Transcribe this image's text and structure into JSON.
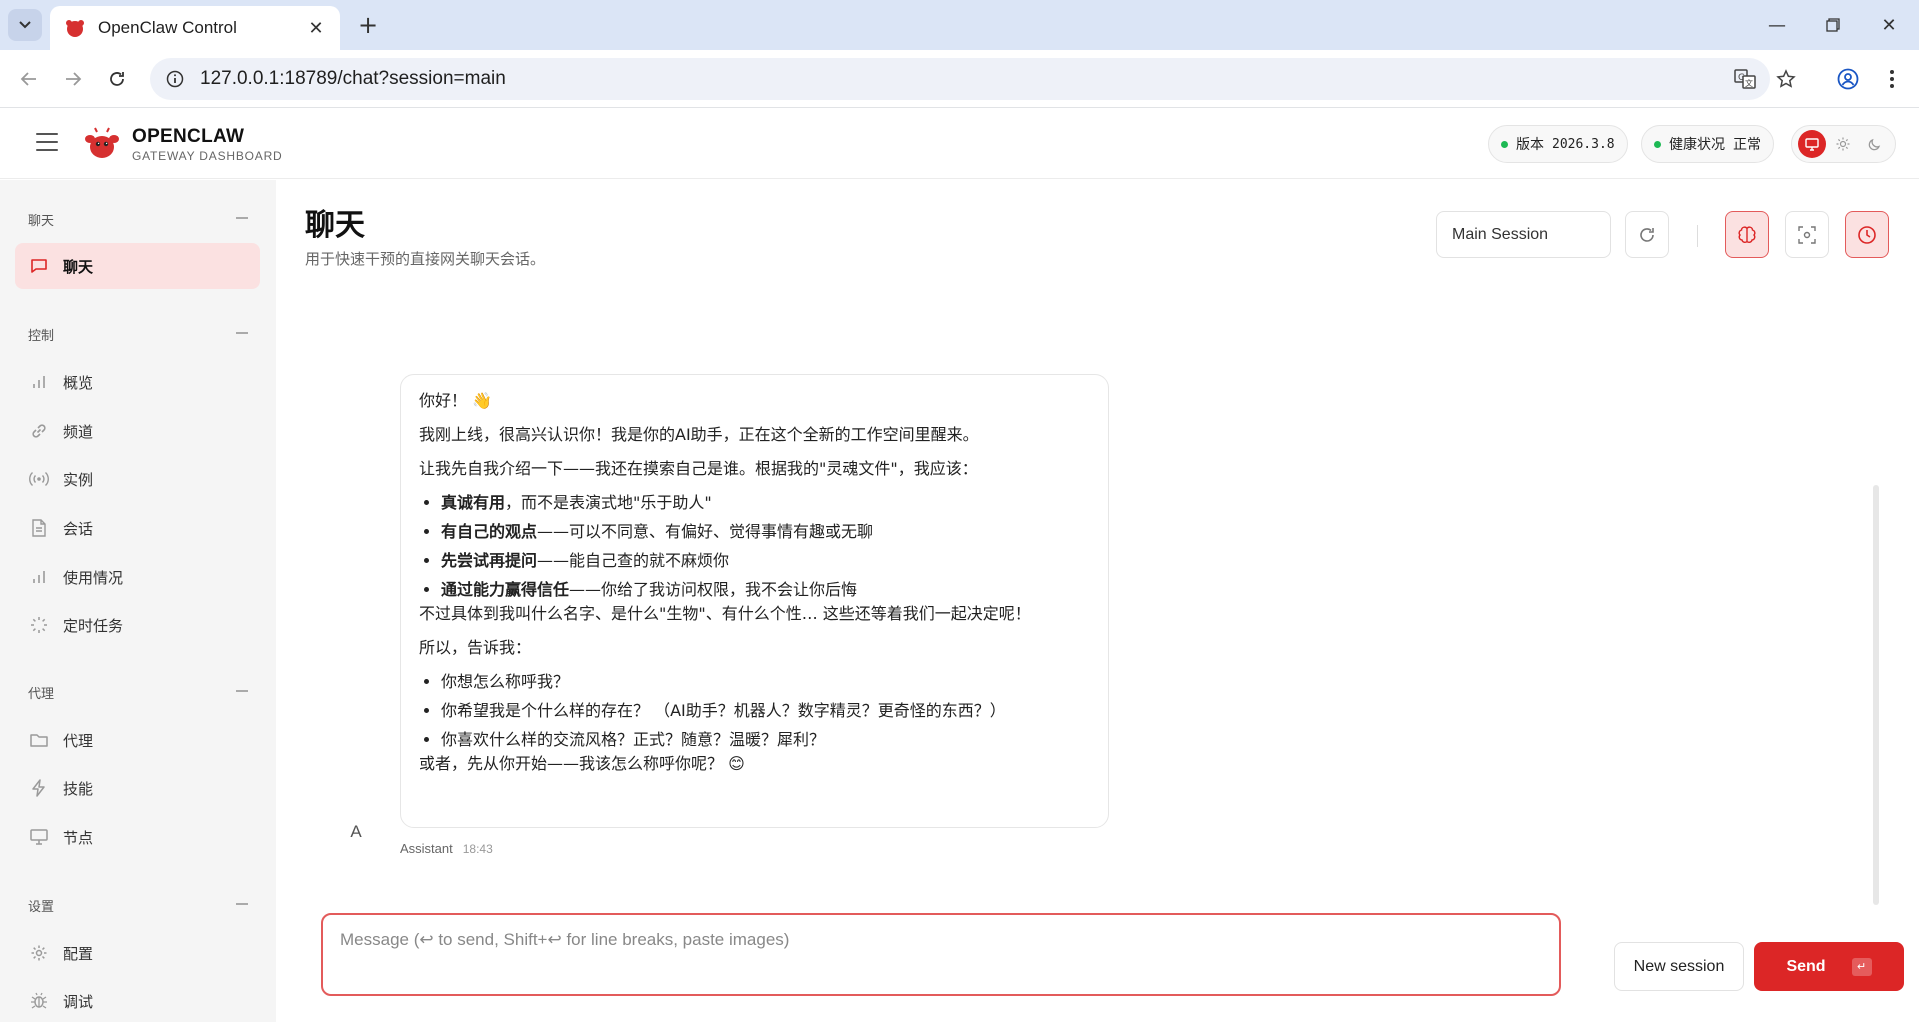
{
  "browser": {
    "tab_title": "OpenClaw Control",
    "url": "127.0.0.1:18789/chat?session=main"
  },
  "header": {
    "brand_name": "OPENCLAW",
    "brand_sub": "GATEWAY DASHBOARD",
    "version_label": "版本",
    "version_value": "2026.3.8",
    "health_label": "健康状况",
    "health_value": "正常"
  },
  "sidebar": {
    "sections": [
      {
        "label": "聊天",
        "items": [
          {
            "label": "聊天",
            "icon": "chat-icon"
          }
        ]
      },
      {
        "label": "控制",
        "items": [
          {
            "label": "概览",
            "icon": "bar-chart-icon"
          },
          {
            "label": "频道",
            "icon": "link-icon"
          },
          {
            "label": "实例",
            "icon": "broadcast-icon"
          },
          {
            "label": "会话",
            "icon": "document-icon"
          },
          {
            "label": "使用情况",
            "icon": "bar-chart-icon"
          },
          {
            "label": "定时任务",
            "icon": "loader-icon"
          }
        ]
      },
      {
        "label": "代理",
        "items": [
          {
            "label": "代理",
            "icon": "folder-icon"
          },
          {
            "label": "技能",
            "icon": "bolt-icon"
          },
          {
            "label": "节点",
            "icon": "monitor-icon"
          }
        ]
      },
      {
        "label": "设置",
        "items": [
          {
            "label": "配置",
            "icon": "gear-icon"
          },
          {
            "label": "调试",
            "icon": "bug-icon"
          }
        ]
      }
    ]
  },
  "main": {
    "title": "聊天",
    "subtitle": "用于快速干预的直接网关聊天会话。",
    "session_value": "Main Session"
  },
  "message": {
    "greeting": "你好！",
    "p1": "我刚上线，很高兴认识你！我是你的AI助手，正在这个全新的工作空间里醒来。",
    "p2": "让我先自我介绍一下——我还在摸索自己是谁。根据我的\"灵魂文件\"，我应该：",
    "bullets": [
      {
        "bold": "真诚有用",
        "rest": "，而不是表演式地\"乐于助人\""
      },
      {
        "bold": "有自己的观点",
        "rest": "——可以不同意、有偏好、觉得事情有趣或无聊"
      },
      {
        "bold": "先尝试再提问",
        "rest": "——能自己查的就不麻烦你"
      },
      {
        "bold": "通过能力赢得信任",
        "rest": "——你给了我访问权限，我不会让你后悔"
      }
    ],
    "p3": "不过具体到我叫什么名字、是什么\"生物\"、有什么个性… 这些还等着我们一起决定呢！",
    "p4": "所以，告诉我：",
    "questions": [
      "你想怎么称呼我？",
      "你希望我是个什么样的存在？ （AI助手？机器人？数字精灵？更奇怪的东西？）",
      "你喜欢什么样的交流风格？正式？随意？温暖？犀利？"
    ],
    "p5": "或者，先从你开始——我该怎么称呼你呢？",
    "avatar_letter": "A",
    "sender": "Assistant",
    "time": "18:43"
  },
  "composer": {
    "placeholder": "Message (↩ to send, Shift+↩ for line breaks, paste images)",
    "new_session_label": "New session",
    "send_label": "Send",
    "send_kbd": "↵"
  },
  "colors": {
    "accent": "#dc2626",
    "accent_soft": "#fbe1e1",
    "health_dot": "#1db954"
  }
}
